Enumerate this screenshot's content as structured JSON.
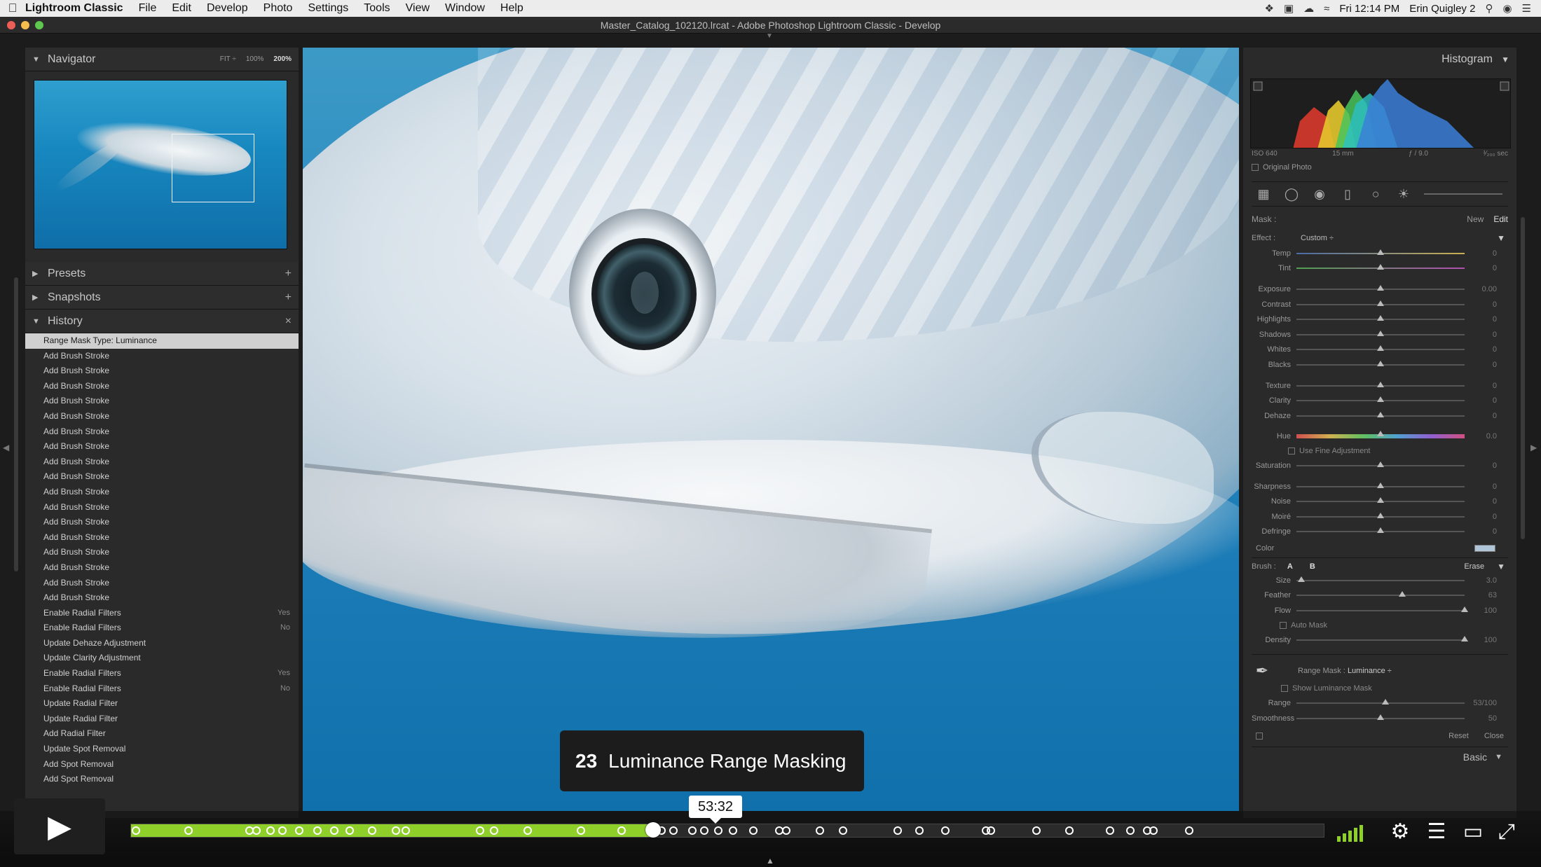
{
  "menubar": {
    "app": "Lightroom Classic",
    "items": [
      "File",
      "Edit",
      "Develop",
      "Photo",
      "Settings",
      "Tools",
      "View",
      "Window",
      "Help"
    ],
    "clock": "Fri 12:14 PM",
    "user": "Erin Quigley 2"
  },
  "window": {
    "title": "Master_Catalog_102120.lrcat - Adobe Photoshop Lightroom Classic - Develop"
  },
  "navigator": {
    "title": "Navigator",
    "zoom": [
      "FIT ÷",
      "100%",
      "200%"
    ],
    "zoom_selected": "200%"
  },
  "presets": {
    "title": "Presets"
  },
  "snapshots": {
    "title": "Snapshots"
  },
  "history": {
    "title": "History",
    "items": [
      {
        "label": "Range Mask Type: Luminance",
        "value": ""
      },
      {
        "label": "Add Brush Stroke",
        "value": ""
      },
      {
        "label": "Add Brush Stroke",
        "value": ""
      },
      {
        "label": "Add Brush Stroke",
        "value": ""
      },
      {
        "label": "Add Brush Stroke",
        "value": ""
      },
      {
        "label": "Add Brush Stroke",
        "value": ""
      },
      {
        "label": "Add Brush Stroke",
        "value": ""
      },
      {
        "label": "Add Brush Stroke",
        "value": ""
      },
      {
        "label": "Add Brush Stroke",
        "value": ""
      },
      {
        "label": "Add Brush Stroke",
        "value": ""
      },
      {
        "label": "Add Brush Stroke",
        "value": ""
      },
      {
        "label": "Add Brush Stroke",
        "value": ""
      },
      {
        "label": "Add Brush Stroke",
        "value": ""
      },
      {
        "label": "Add Brush Stroke",
        "value": ""
      },
      {
        "label": "Add Brush Stroke",
        "value": ""
      },
      {
        "label": "Add Brush Stroke",
        "value": ""
      },
      {
        "label": "Add Brush Stroke",
        "value": ""
      },
      {
        "label": "Add Brush Stroke",
        "value": ""
      },
      {
        "label": "Enable Radial Filters",
        "value": "Yes"
      },
      {
        "label": "Enable Radial Filters",
        "value": "No"
      },
      {
        "label": "Update Dehaze Adjustment",
        "value": ""
      },
      {
        "label": "Update Clarity Adjustment",
        "value": ""
      },
      {
        "label": "Enable Radial Filters",
        "value": "Yes"
      },
      {
        "label": "Enable Radial Filters",
        "value": "No"
      },
      {
        "label": "Update Radial Filter",
        "value": ""
      },
      {
        "label": "Update Radial Filter",
        "value": ""
      },
      {
        "label": "Add Radial Filter",
        "value": ""
      },
      {
        "label": "Update Spot Removal",
        "value": ""
      },
      {
        "label": "Add Spot Removal",
        "value": ""
      },
      {
        "label": "Add Spot Removal",
        "value": ""
      }
    ]
  },
  "histogram": {
    "title": "Histogram",
    "iso": "ISO 640",
    "focal": "15 mm",
    "aperture": "ƒ / 9.0",
    "shutter": "¹⁄₂₀₀ sec",
    "original_photo": "Original Photo"
  },
  "mask": {
    "label": "Mask :",
    "new": "New",
    "edit": "Edit",
    "effect_label": "Effect :",
    "effect_value": "Custom ÷"
  },
  "sliders": [
    {
      "label": "Temp",
      "pos": 0.5,
      "value": "0",
      "kind": "temp"
    },
    {
      "label": "Tint",
      "pos": 0.5,
      "value": "0",
      "kind": "tint"
    },
    {
      "label": "Exposure",
      "pos": 0.5,
      "value": "0.00",
      "gap": true
    },
    {
      "label": "Contrast",
      "pos": 0.5,
      "value": "0"
    },
    {
      "label": "Highlights",
      "pos": 0.5,
      "value": "0"
    },
    {
      "label": "Shadows",
      "pos": 0.5,
      "value": "0"
    },
    {
      "label": "Whites",
      "pos": 0.5,
      "value": "0"
    },
    {
      "label": "Blacks",
      "pos": 0.5,
      "value": "0"
    },
    {
      "label": "Texture",
      "pos": 0.5,
      "value": "0",
      "gap": true
    },
    {
      "label": "Clarity",
      "pos": 0.5,
      "value": "0"
    },
    {
      "label": "Dehaze",
      "pos": 0.5,
      "value": "0"
    }
  ],
  "hue": {
    "label": "Hue",
    "pos": 0.5,
    "value": "0.0"
  },
  "fine_adjust": "Use Fine Adjustment",
  "sliders2": [
    {
      "label": "Saturation",
      "pos": 0.5,
      "value": "0"
    },
    {
      "label": "Sharpness",
      "pos": 0.5,
      "value": "0",
      "gap": true
    },
    {
      "label": "Noise",
      "pos": 0.5,
      "value": "0"
    },
    {
      "label": "Moiré",
      "pos": 0.5,
      "value": "0"
    },
    {
      "label": "Defringe",
      "pos": 0.5,
      "value": "0"
    }
  ],
  "color_label": "Color",
  "brush": {
    "label": "Brush :",
    "a": "A",
    "b": "B",
    "erase": "Erase",
    "sliders": [
      {
        "label": "Size",
        "pos": 0.03,
        "value": "3.0"
      },
      {
        "label": "Feather",
        "pos": 0.63,
        "value": "63"
      },
      {
        "label": "Flow",
        "pos": 1.0,
        "value": "100"
      }
    ],
    "auto_mask": "Auto Mask",
    "density": {
      "label": "Density",
      "pos": 1.0,
      "value": "100"
    }
  },
  "range_mask": {
    "label": "Range Mask :",
    "type": "Luminance ÷",
    "show": "Show Luminance Mask",
    "range": {
      "label": "Range",
      "pos": 0.53,
      "value": "53/100"
    },
    "smoothness": {
      "label": "Smoothness",
      "pos": 0.5,
      "value": "50"
    },
    "reset": "Reset",
    "close": "Close"
  },
  "basic": {
    "title": "Basic"
  },
  "chapter": {
    "number": "23",
    "title": "Luminance Range Masking"
  },
  "player": {
    "timecode": "53:32",
    "progress": 0.437,
    "markers": [
      0.004,
      0.048,
      0.099,
      0.105,
      0.117,
      0.127,
      0.141,
      0.156,
      0.17,
      0.183,
      0.202,
      0.222,
      0.23,
      0.292,
      0.304,
      0.332,
      0.377,
      0.411,
      0.444,
      0.454,
      0.47,
      0.48,
      0.492,
      0.504,
      0.521,
      0.543,
      0.549,
      0.577,
      0.596,
      0.642,
      0.66,
      0.682,
      0.716,
      0.72,
      0.758,
      0.786,
      0.82,
      0.837,
      0.851,
      0.856,
      0.886
    ]
  }
}
